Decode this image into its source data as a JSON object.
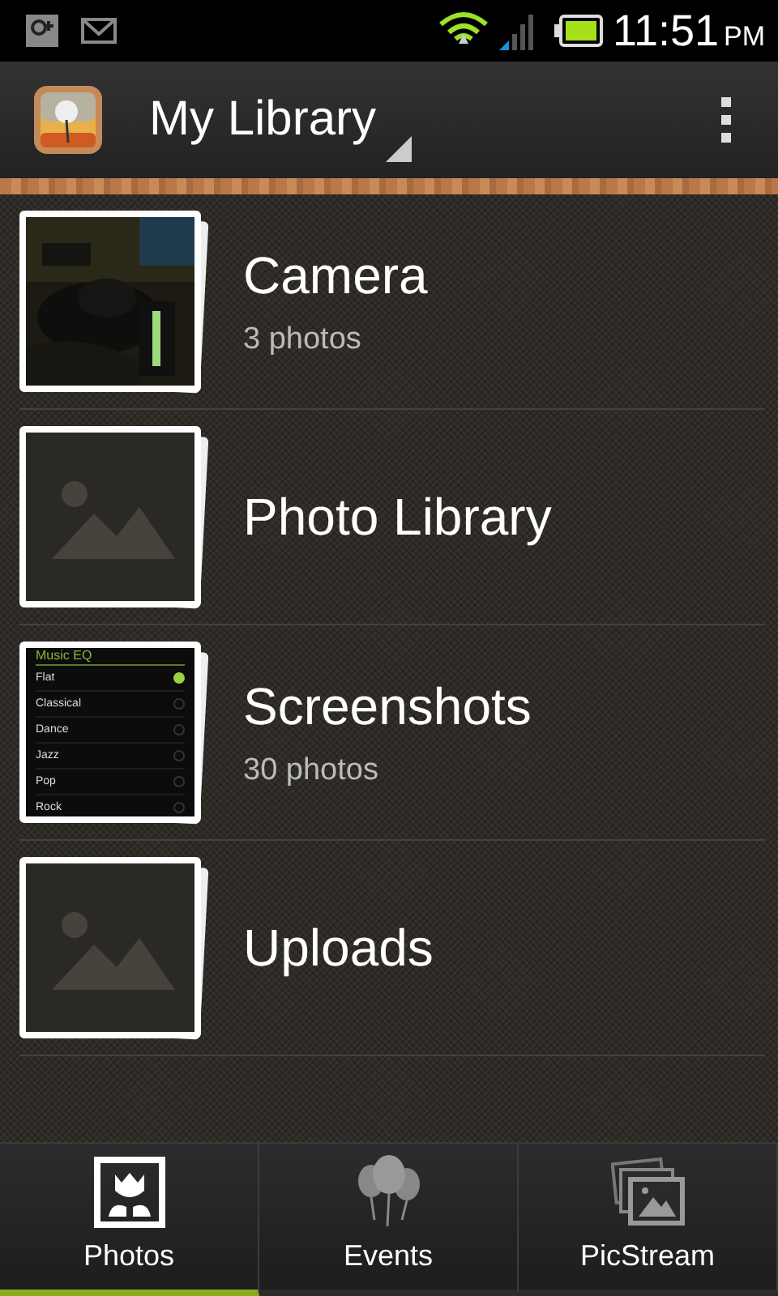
{
  "status_bar": {
    "time": "11:51",
    "ampm": "PM"
  },
  "action_bar": {
    "title": "My Library"
  },
  "albums": [
    {
      "title": "Camera",
      "subtitle": "3 photos"
    },
    {
      "title": "Photo Library",
      "thumb": {
        "kind": "placeholder"
      }
    },
    {
      "title": "Screenshots",
      "subtitle": "30 photos",
      "thumb": {
        "kind": "screenshot",
        "heading": "Music EQ",
        "options": [
          {
            "label": "Flat",
            "selected": true
          },
          {
            "label": "Classical",
            "selected": false
          },
          {
            "label": "Dance",
            "selected": false
          },
          {
            "label": "Jazz",
            "selected": false
          },
          {
            "label": "Pop",
            "selected": false
          },
          {
            "label": "Rock",
            "selected": false
          }
        ]
      }
    },
    {
      "title": "Uploads",
      "thumb": {
        "kind": "placeholder"
      }
    }
  ],
  "tabs": [
    {
      "label": "Photos",
      "selected": true
    },
    {
      "label": "Events",
      "selected": false
    },
    {
      "label": "PicStream",
      "selected": false
    }
  ]
}
